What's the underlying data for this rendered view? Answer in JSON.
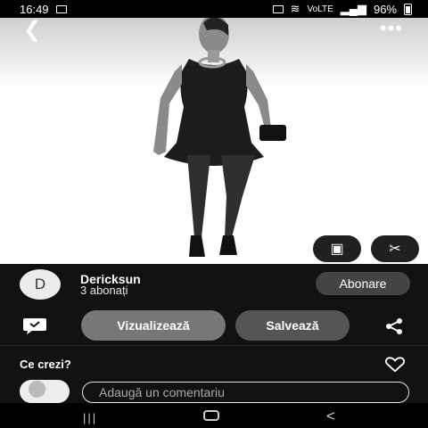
{
  "status_bar": {
    "time": "16:49",
    "network": "VoLTE",
    "battery": "96%"
  },
  "pin": {
    "user": "Dericksun",
    "subscribers": "3 abonați",
    "avatar_letter": "D"
  },
  "actions": {
    "subscribe": "Abonare",
    "view": "Vizualizează",
    "save": "Salvează"
  },
  "comments": {
    "prompt": "Ce crezi?",
    "placeholder": "Adaugă un comentariu"
  },
  "icons": [
    "back-icon",
    "more-icon",
    "lens-icon",
    "scissors-icon",
    "comment-icon",
    "share-icon",
    "heart-icon"
  ]
}
